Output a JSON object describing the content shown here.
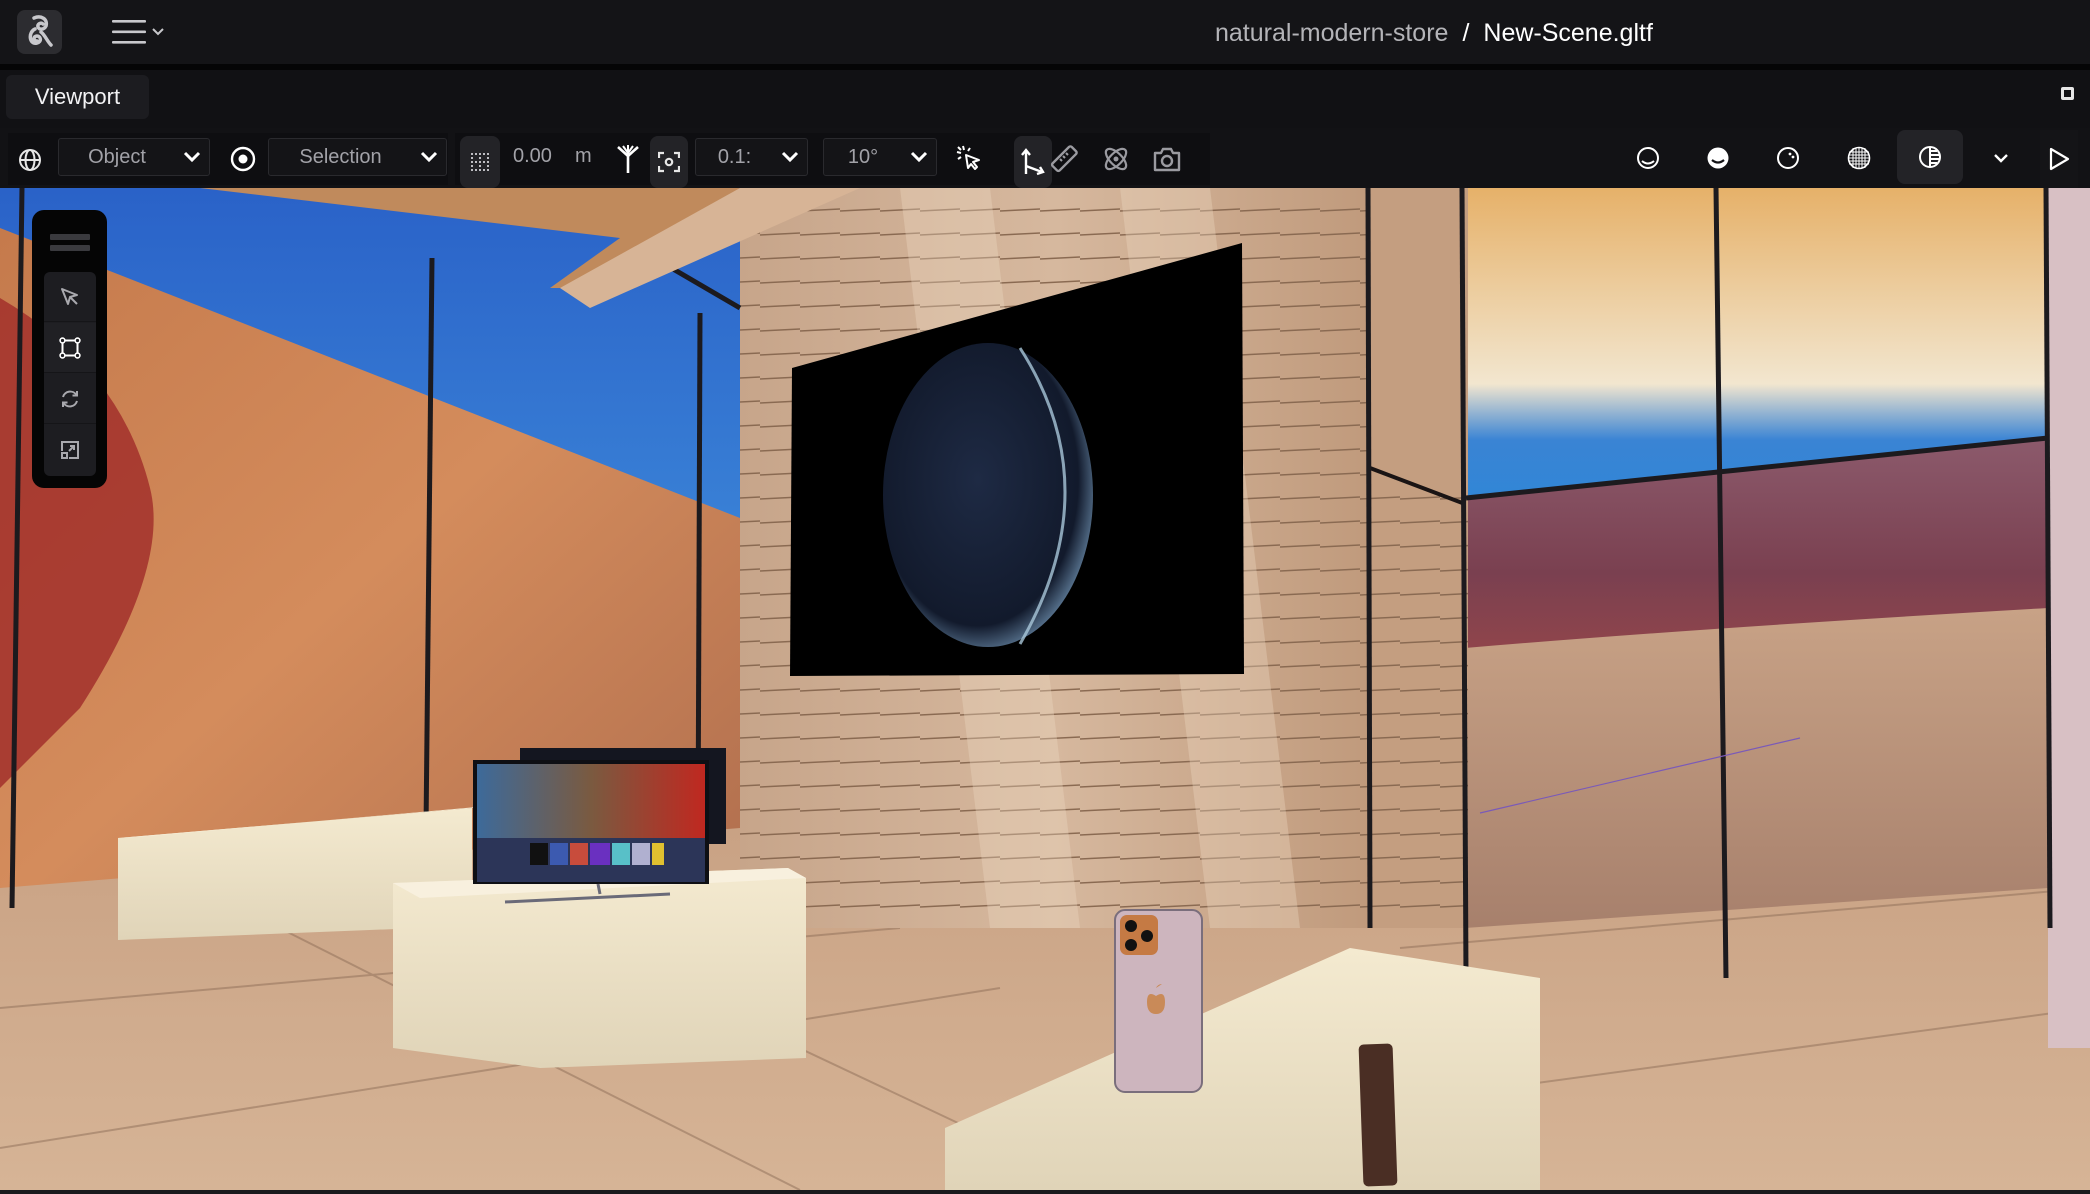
{
  "header": {
    "project": "natural-modern-store",
    "separator": "/",
    "file": "New-Scene.gltf",
    "logo_icon": "app-logo",
    "menu_icon": "hamburger-menu-icon"
  },
  "panel": {
    "tab_label": "Viewport",
    "maximize_icon": "maximize-icon"
  },
  "toolbar": {
    "space_icon": "globe-icon",
    "space_mode": "Object",
    "pivot_icon": "pivot-target-icon",
    "pivot_mode": "Selection",
    "grid_snap_icon": "grid-snap-icon",
    "grid_snap_value": "0.00",
    "grid_snap_unit": "m",
    "antenna_icon": "snap-antenna-icon",
    "focus_icon": "focus-frame-icon",
    "translate_snap": "0.1:",
    "rotate_snap": "10°",
    "select_click_icon": "click-select-icon",
    "axes_icon": "local-axes-icon",
    "ruler_icon": "ruler-icon",
    "atom_icon": "physics-atom-icon",
    "camera_icon": "screenshot-camera-icon",
    "shading_modes": [
      {
        "name": "wireframe-shading-icon",
        "active": false
      },
      {
        "name": "solid-shading-icon",
        "active": false
      },
      {
        "name": "material-shading-icon",
        "active": false
      },
      {
        "name": "globe-grid-shading-icon",
        "active": false
      },
      {
        "name": "rendered-shading-icon",
        "active": true
      }
    ],
    "more_icon": "chevron-down-icon",
    "play_icon": "play-icon"
  },
  "float_tools": {
    "handle_icon": "drag-handle-icon",
    "items": [
      {
        "name": "select-tool",
        "icon": "cursor-arrow-icon",
        "active": false
      },
      {
        "name": "transform-tool",
        "icon": "bounding-box-icon",
        "active": true
      },
      {
        "name": "rotate-tool",
        "icon": "rotate-arrows-icon",
        "active": false
      },
      {
        "name": "scale-tool",
        "icon": "scale-arrow-icon",
        "active": false
      }
    ]
  },
  "scene": {
    "objects": [
      "desert-backdrop",
      "wooden-wall",
      "earth-display-screen",
      "television",
      "display-pedestal",
      "bench-block",
      "smartphone-back",
      "smartphone-side",
      "glass-window-frames",
      "wooden-ceiling-beam",
      "floor-tiles"
    ]
  },
  "colors": {
    "ui_bg": "#141417",
    "sky_blue": "#2f7fd8",
    "sand": "#c98456",
    "wood": "#c8a488",
    "pedestal": "#f2e7cc"
  }
}
